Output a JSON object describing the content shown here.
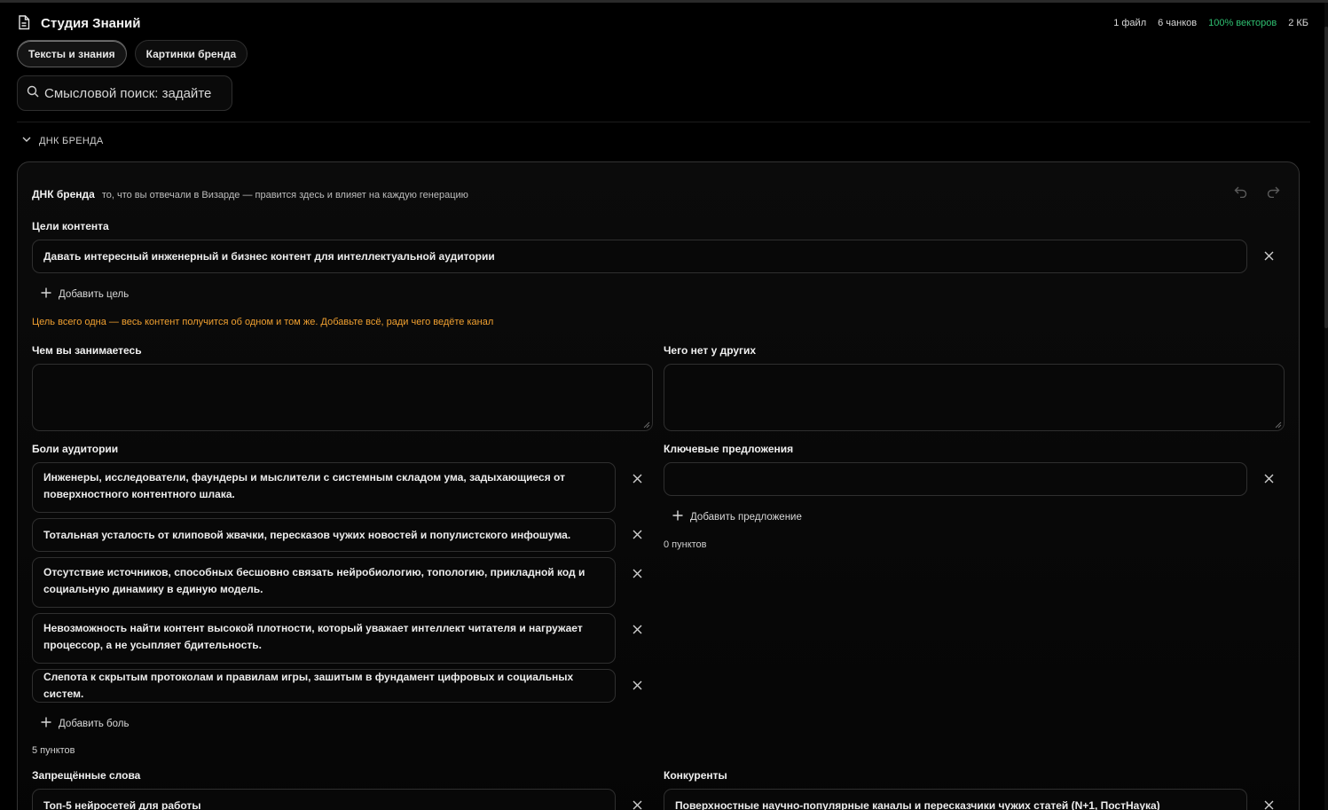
{
  "header": {
    "title": "Студия Знаний",
    "stats": {
      "files": "1 файл",
      "chunks": "6 чанков",
      "vectors": "100% векторов",
      "size": "2 КБ"
    },
    "accent_green": "#2fbf71"
  },
  "tabs": [
    {
      "label": "Тексты и знания",
      "active": true
    },
    {
      "label": "Картинки бренда",
      "active": false
    }
  ],
  "search": {
    "placeholder": "Смысловой поиск: задайте"
  },
  "section": {
    "label": "ДНК БРЕНДА"
  },
  "card": {
    "title": "ДНК бренда",
    "subtitle": "то, что вы отвечали в Визарде — правится здесь и влияет на каждую генерацию",
    "goals": {
      "label": "Цели контента",
      "items": [
        "Давать интересный инженерный и бизнес контент для интеллектуальной аудитории"
      ],
      "add_label": "Добавить цель",
      "warning": "Цель всего одна — весь контент получится об одном и том же. Добавьте всё, ради чего ведёте канал",
      "warning_color": "#f0a030"
    },
    "what_you_do": {
      "label": "Чем вы занимаетесь",
      "value": ""
    },
    "what_others_lack": {
      "label": "Чего нет у других",
      "value": ""
    },
    "pains": {
      "label": "Боли аудитории",
      "items": [
        "Инженеры, исследователи, фаундеры и мыслители с системным складом ума, задыхающиеся от поверхностного контентного шлака.",
        "Тотальная усталость от клиповой жвачки, пересказов чужих новостей и популистского инфошума.",
        "Отсутствие источников, способных бесшовно связать нейробиологию, топологию, прикладной код и социальную динамику в единую модель.",
        "Невозможность найти контент высокой плотности, который уважает интеллект читателя и нагружает процессор, а не усыпляет бдительность.",
        "Слепота к скрытым протоколам и правилам игры, зашитым в фундамент цифровых и социальных систем."
      ],
      "add_label": "Добавить боль",
      "count": "5 пунктов"
    },
    "offers": {
      "label": "Ключевые предложения",
      "items": [
        ""
      ],
      "add_label": "Добавить предложение",
      "count": "0 пунктов"
    },
    "banned_words": {
      "label": "Запрещённые слова",
      "items": [
        "Топ-5 нейросетей для работы"
      ]
    },
    "competitors": {
      "label": "Конкуренты",
      "items": [
        "Поверхностные научно-популярные каналы и пересказчики чужих статей (N+1, ПостНаука)"
      ]
    }
  }
}
